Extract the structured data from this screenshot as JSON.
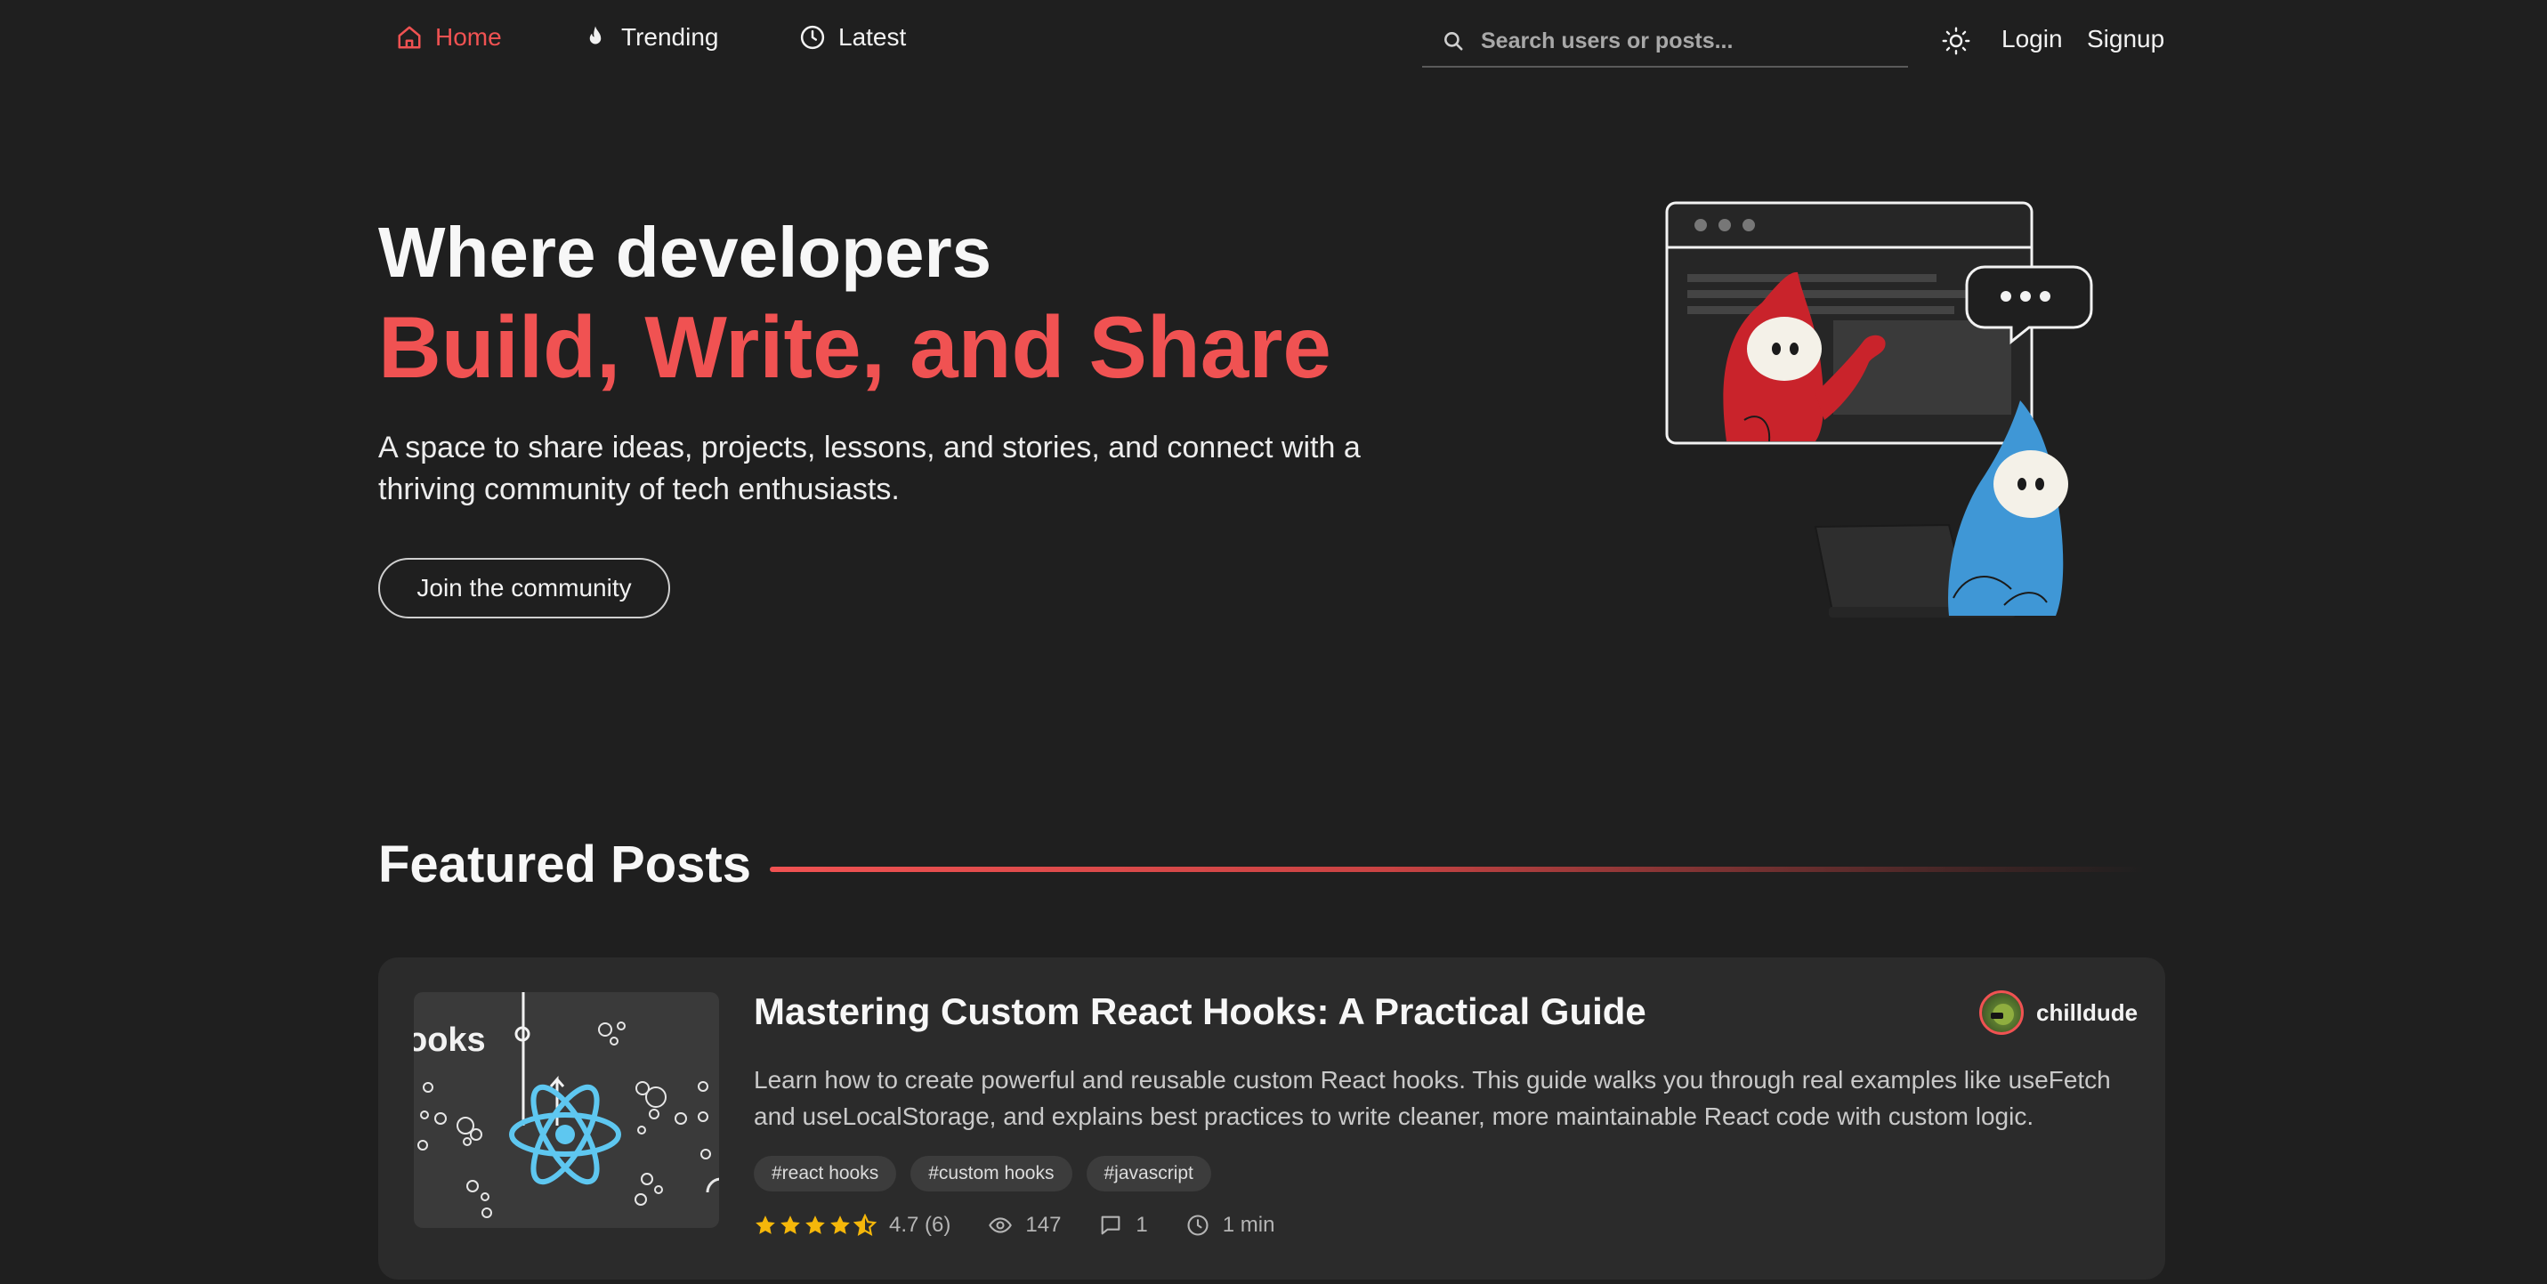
{
  "nav": {
    "home": "Home",
    "trending": "Trending",
    "latest": "Latest",
    "search_placeholder": "Search users or posts...",
    "login": "Login",
    "signup": "Signup"
  },
  "hero": {
    "line1": "Where developers",
    "line2": "Build, Write, and Share",
    "description": "A space to share ideas, projects, lessons, and stories, and connect with a thriving community of tech enthusiasts.",
    "cta": "Join the community"
  },
  "featured": {
    "heading": "Featured Posts",
    "post": {
      "thumb_text": "ooks",
      "title": "Mastering Custom React Hooks: A Practical Guide",
      "description": "Learn how to create powerful and reusable custom React hooks. This guide walks you through real examples like useFetch and useLocalStorage, and explains best practices to write cleaner, more maintainable React code with custom logic.",
      "tags": [
        "#react hooks",
        "#custom hooks",
        "#javascript"
      ],
      "rating": 4.7,
      "rating_text": "4.7 (6)",
      "views": "147",
      "comments": "1",
      "read_time": "1 min",
      "author": "chilldude"
    }
  },
  "colors": {
    "accent": "#f05252",
    "background": "#1f1f1f",
    "card": "#2b2b2b",
    "star": "#f5b70a"
  }
}
